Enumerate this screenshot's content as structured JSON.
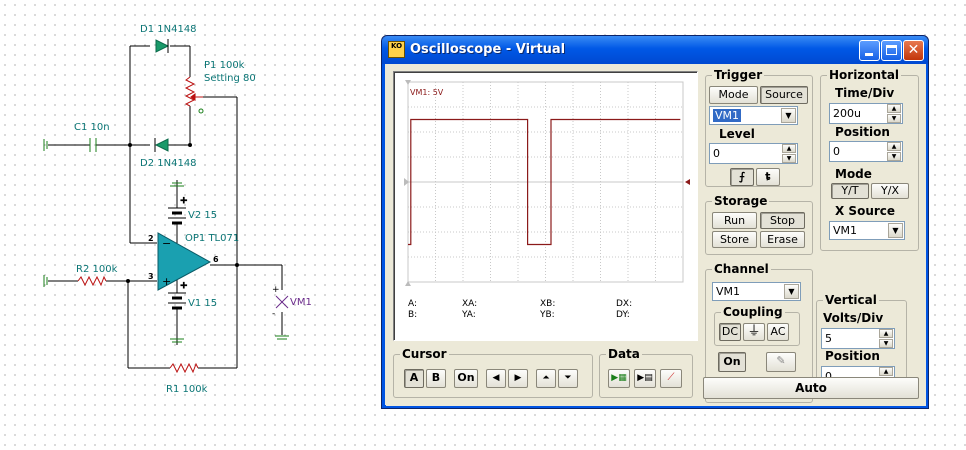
{
  "circuit": {
    "d1": {
      "name": "D1",
      "part": "1N4148"
    },
    "d2": {
      "name": "D2",
      "part": "1N4148"
    },
    "p1": {
      "name": "P1",
      "value": "100k",
      "setting": "Setting 80"
    },
    "c1": {
      "name": "C1",
      "value": "10n"
    },
    "v2": {
      "name": "V2",
      "value": "15"
    },
    "v1": {
      "name": "V1",
      "value": "15"
    },
    "op1": {
      "name": "OP1",
      "part": "TL071"
    },
    "r2": {
      "name": "R2",
      "value": "100k"
    },
    "r1": {
      "name": "R1",
      "value": "100k"
    },
    "vm1": "VM1",
    "pins": {
      "inv": "2",
      "noninv": "3",
      "out": "6"
    }
  },
  "window": {
    "title": "Oscilloscope - Virtual",
    "icon_text": "KO",
    "controls": [
      "minimize-icon",
      "maximize-icon",
      "close-icon"
    ]
  },
  "screen": {
    "channel_label": "VM1: 5V",
    "readouts": {
      "a": "A:",
      "b": "B:",
      "xa": "XA:",
      "ya": "YA:",
      "xb": "XB:",
      "yb": "YB:",
      "dx": "DX:",
      "dy": "DY:"
    },
    "trace_color": "#8b1a1a",
    "waveform": {
      "x_div": [
        0,
        0.1,
        0.1,
        4.35,
        4.35,
        5.2,
        5.2,
        9.9
      ],
      "y_div": [
        -2.5,
        -2.5,
        2.5,
        2.5,
        -2.5,
        -2.5,
        2.5,
        2.5
      ]
    }
  },
  "trigger": {
    "title": "Trigger",
    "mode_label": "Mode",
    "source_label": "Source",
    "source_value": "VM1",
    "level_label": "Level",
    "level_value": "0",
    "edge_rise_icon": "rising-edge-icon",
    "edge_fall_icon": "falling-edge-icon"
  },
  "horizontal": {
    "title": "Horizontal",
    "time_div_label": "Time/Div",
    "time_div_value": "200u",
    "position_label": "Position",
    "position_value": "0",
    "mode_label": "Mode",
    "mode_yt": "Y/T",
    "mode_yx": "Y/X",
    "xsource_label": "X Source",
    "xsource_value": "VM1"
  },
  "storage": {
    "title": "Storage",
    "run": "Run",
    "stop": "Stop",
    "store": "Store",
    "erase": "Erase"
  },
  "channel": {
    "title": "Channel",
    "value": "VM1",
    "coupling_title": "Coupling",
    "dc": "DC",
    "ac": "AC",
    "gnd_icon": "ground-icon",
    "on": "On",
    "pen_icon": "pen-icon"
  },
  "vertical": {
    "title": "Vertical",
    "volts_div_label": "Volts/Div",
    "volts_div_value": "5",
    "position_label": "Position",
    "position_value": "0"
  },
  "cursor": {
    "title": "Cursor",
    "a": "A",
    "b": "B",
    "on": "On"
  },
  "data_group": {
    "title": "Data"
  },
  "auto_label": "Auto"
}
